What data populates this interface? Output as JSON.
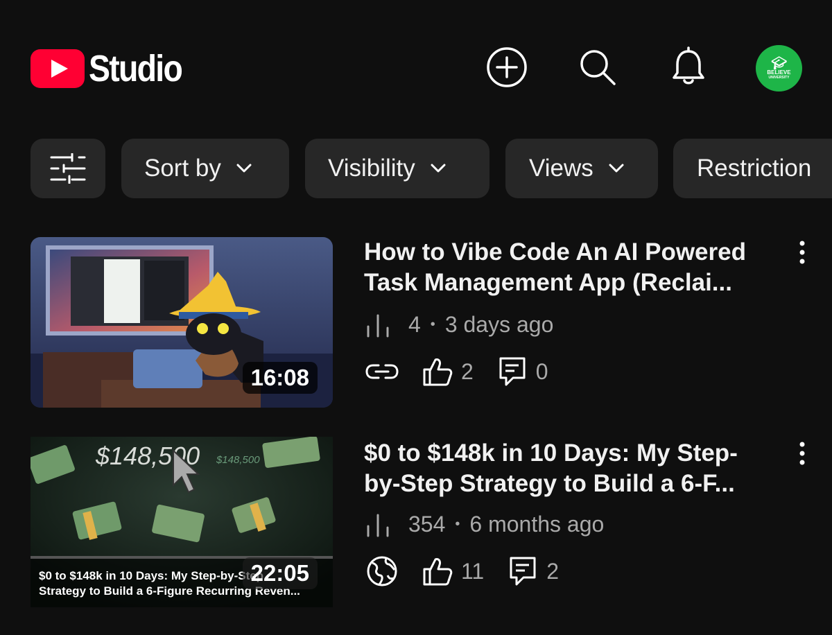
{
  "header": {
    "app_name": "Studio",
    "avatar_text_1": "BELIEVE",
    "avatar_text_2": "UNIVERSITY",
    "icons": [
      "create-icon",
      "search-icon",
      "bell-icon"
    ]
  },
  "filters": [
    {
      "label": "Sort by"
    },
    {
      "label": "Visibility"
    },
    {
      "label": "Views"
    },
    {
      "label": "Restriction"
    }
  ],
  "videos": [
    {
      "title_line_1": "How to Vibe Code An AI Powered",
      "title_line_2": "Task Management App (Reclai...",
      "duration": "16:08",
      "views": "4",
      "age": "3 days ago",
      "visibility_icon": "link-icon",
      "likes": "2",
      "comments": "0"
    },
    {
      "title_line_1": "$0 to $148k in 10 Days: My Step-",
      "title_line_2": "by-Step Strategy to Build a 6-F...",
      "duration": "22:05",
      "views": "354",
      "age": "6 months ago",
      "visibility_icon": "globe-icon",
      "likes": "11",
      "comments": "2",
      "thumb_text_amount": "$148,500",
      "thumb_text_amount_small": "$148,500",
      "thumb_caption_1": "$0 to $148k in 10 Days: My Step-by-Step",
      "thumb_caption_2": "Strategy to Build a 6-Figure Recurring Reven..."
    }
  ],
  "colors": {
    "background": "#0f0f0f",
    "chip": "#272727",
    "brand_red": "#ff0033",
    "secondary_text": "#aaaaaa",
    "avatar_green": "#1eb548"
  }
}
